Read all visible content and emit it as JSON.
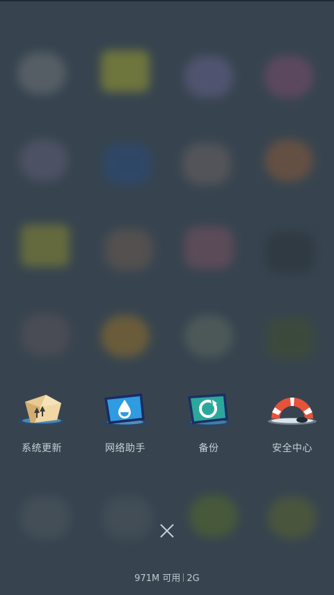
{
  "tools": [
    {
      "label": "系统更新",
      "icon": "system-update-box-icon"
    },
    {
      "label": "网络助手",
      "icon": "network-assistant-icon"
    },
    {
      "label": "备份",
      "icon": "backup-icon"
    },
    {
      "label": "安全中心",
      "icon": "lifebuoy-security-icon"
    }
  ],
  "memory": {
    "available": "971M 可用",
    "total": "2G"
  },
  "close_icon": "close-icon",
  "colors": {
    "background": "#37444f",
    "label": "#c8d0d6"
  }
}
